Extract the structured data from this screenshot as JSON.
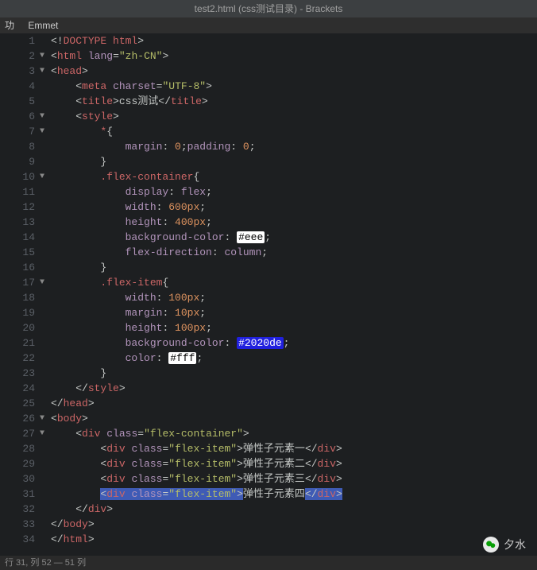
{
  "titlebar": "test2.html (css测试目录) - Brackets",
  "menu": {
    "item0": "功",
    "item1": "Emmet"
  },
  "watermark": {
    "label": "夕水"
  },
  "statusbar": "行 31, 列 52 — 51 列",
  "gutter": {
    "lines": [
      "1",
      "2",
      "3",
      "4",
      "5",
      "6",
      "7",
      "8",
      "9",
      "10",
      "11",
      "12",
      "13",
      "14",
      "15",
      "16",
      "17",
      "18",
      "19",
      "20",
      "21",
      "22",
      "23",
      "24",
      "25",
      "26",
      "27",
      "28",
      "29",
      "30",
      "31",
      "32",
      "33",
      "34"
    ],
    "folds": [
      2,
      3,
      6,
      7,
      10,
      17,
      26,
      27
    ]
  },
  "code": {
    "l1": {
      "ind": "",
      "open": "<!",
      "tag": "DOCTYPE html",
      "close": ">"
    },
    "l2": {
      "ind": "",
      "t": "html",
      "a": "lang",
      "v": "\"zh-CN\""
    },
    "l3": {
      "ind": "",
      "t": "head"
    },
    "l4": {
      "ind": "    ",
      "t": "meta",
      "a": "charset",
      "v": "\"UTF-8\""
    },
    "l5": {
      "ind": "    ",
      "t": "title",
      "text": "css测试",
      "ct": "title"
    },
    "l6": {
      "ind": "    ",
      "t": "style"
    },
    "l7": {
      "ind": "        ",
      "sel": "*",
      "b": "{"
    },
    "l8": {
      "ind": "            ",
      "p1": "margin",
      "v1": "0",
      "p2": "padding",
      "v2": "0"
    },
    "l9": {
      "ind": "        ",
      "b": "}"
    },
    "l10": {
      "ind": "        ",
      "sel": ".flex-container",
      "b": "{"
    },
    "l11": {
      "ind": "            ",
      "p": "display",
      "v": "flex"
    },
    "l12": {
      "ind": "            ",
      "p": "width",
      "v": "600px"
    },
    "l13": {
      "ind": "            ",
      "p": "height",
      "v": "400px"
    },
    "l14": {
      "ind": "            ",
      "p": "background-color",
      "v": "#eee"
    },
    "l15": {
      "ind": "            ",
      "p": "flex-direction",
      "v": "column"
    },
    "l16": {
      "ind": "        ",
      "b": "}"
    },
    "l17": {
      "ind": "        ",
      "sel": ".flex-item",
      "b": "{"
    },
    "l18": {
      "ind": "            ",
      "p": "width",
      "v": "100px"
    },
    "l19": {
      "ind": "            ",
      "p": "margin",
      "v": "10px"
    },
    "l20": {
      "ind": "            ",
      "p": "height",
      "v": "100px"
    },
    "l21": {
      "ind": "            ",
      "p": "background-color",
      "v": "#2020de"
    },
    "l22": {
      "ind": "            ",
      "p": "color",
      "v": "#fff"
    },
    "l23": {
      "ind": "        ",
      "b": "}"
    },
    "l24": {
      "ind": "    ",
      "ct": "style"
    },
    "l25": {
      "ind": "",
      "ct": "head"
    },
    "l26": {
      "ind": "",
      "t": "body"
    },
    "l27": {
      "ind": "    ",
      "t": "div",
      "a": "class",
      "v": "\"flex-container\""
    },
    "l28": {
      "ind": "        ",
      "t": "div",
      "a": "class",
      "v": "\"flex-item\"",
      "text": "弹性子元素一",
      "ct": "div"
    },
    "l29": {
      "ind": "        ",
      "t": "div",
      "a": "class",
      "v": "\"flex-item\"",
      "text": "弹性子元素二",
      "ct": "div"
    },
    "l30": {
      "ind": "        ",
      "t": "div",
      "a": "class",
      "v": "\"flex-item\"",
      "text": "弹性子元素三",
      "ct": "div"
    },
    "l31": {
      "ind": "        ",
      "t": "div",
      "a": "class",
      "v": "\"flex-item\"",
      "text": "弹性子元素四",
      "ct": "div"
    },
    "l32": {
      "ind": "    ",
      "ct": "div"
    },
    "l33": {
      "ind": "",
      "ct": "body"
    },
    "l34": {
      "ind": "",
      "ct": "html"
    }
  }
}
